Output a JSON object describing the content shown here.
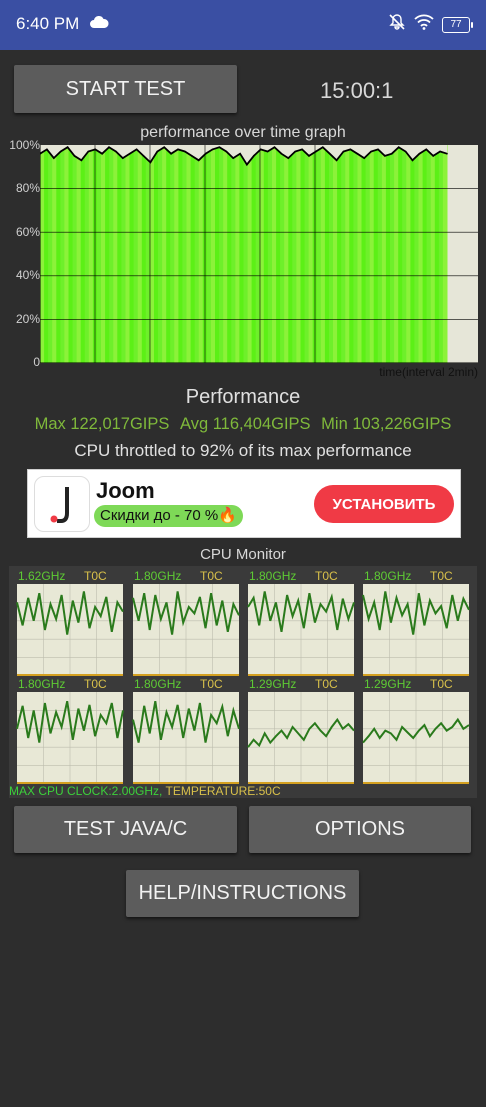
{
  "status_bar": {
    "time": "6:40 PM",
    "battery": "77",
    "icons": [
      "cloud-icon",
      "mute-icon",
      "wifi-icon",
      "battery-icon"
    ]
  },
  "controls": {
    "start_label": "START TEST",
    "timer": "15:00:1"
  },
  "graph": {
    "title": "performance over time graph",
    "y_ticks": [
      "100%",
      "80%",
      "60%",
      "40%",
      "20%",
      "0"
    ],
    "x_label": "time(interval 2min)",
    "colors": {
      "fill": "#5cf016",
      "line": "#000000",
      "background": "#e6e6d8",
      "grid": "#000000"
    }
  },
  "chart_data": {
    "type": "area",
    "title": "performance over time graph",
    "xlabel": "time(interval 2min)",
    "ylabel": "",
    "ylim": [
      0,
      100
    ],
    "y_ticks": [
      "100%",
      "80%",
      "60%",
      "40%",
      "20%",
      "0"
    ],
    "series": [
      {
        "values": [
          96,
          98,
          94,
          97,
          99,
          95,
          93,
          97,
          98,
          96,
          99,
          97,
          94,
          96,
          98,
          95,
          92,
          97,
          99,
          96,
          98,
          97,
          95,
          93,
          96,
          98,
          99,
          97,
          94,
          96,
          91,
          95,
          98,
          97,
          99,
          96,
          94,
          97,
          98,
          95,
          97,
          99,
          96,
          93,
          97,
          98,
          96,
          94,
          97,
          98,
          95,
          96,
          99,
          97,
          93,
          96,
          98,
          95,
          97,
          96
        ]
      }
    ]
  },
  "performance": {
    "title": "Performance",
    "max": "Max 122,017GIPS",
    "avg": "Avg 116,404GIPS",
    "min": "Min 103,226GIPS",
    "throttled": "CPU throttled to 92% of its max performance"
  },
  "ad": {
    "name": "Joom",
    "promo": "Скидки до - 70 %🔥",
    "install": "УСТАНОВИТЬ",
    "icon": "joom-logo-icon"
  },
  "cpu_monitor": {
    "title": "CPU Monitor",
    "cores": [
      {
        "freq": "1.62GHz",
        "temp": "T0C",
        "values": [
          80,
          55,
          85,
          60,
          90,
          50,
          78,
          62,
          88,
          45,
          82,
          58,
          92,
          52,
          75,
          65,
          86,
          48,
          80,
          70
        ]
      },
      {
        "freq": "1.80GHz",
        "temp": "T0C",
        "values": [
          85,
          60,
          90,
          50,
          88,
          62,
          80,
          45,
          92,
          58,
          75,
          68,
          86,
          52,
          90,
          55,
          82,
          48,
          78,
          66
        ]
      },
      {
        "freq": "1.80GHz",
        "temp": "T0C",
        "values": [
          75,
          85,
          55,
          92,
          60,
          80,
          48,
          88,
          65,
          82,
          52,
          90,
          58,
          78,
          70,
          86,
          50,
          84,
          62,
          80
        ]
      },
      {
        "freq": "1.80GHz",
        "temp": "T0C",
        "values": [
          88,
          62,
          80,
          50,
          92,
          58,
          85,
          66,
          78,
          45,
          90,
          55,
          82,
          68,
          76,
          52,
          88,
          60,
          84,
          72
        ]
      },
      {
        "freq": "1.80GHz",
        "temp": "T0C",
        "values": [
          60,
          85,
          50,
          80,
          45,
          88,
          55,
          78,
          62,
          90,
          48,
          82,
          58,
          86,
          52,
          75,
          66,
          88,
          50,
          80
        ]
      },
      {
        "freq": "1.80GHz",
        "temp": "T0C",
        "values": [
          70,
          45,
          85,
          55,
          90,
          48,
          78,
          62,
          86,
          50,
          82,
          58,
          88,
          45,
          75,
          66,
          84,
          52,
          80,
          60
        ]
      },
      {
        "freq": "1.29GHz",
        "temp": "T0C",
        "values": [
          40,
          48,
          42,
          55,
          45,
          52,
          58,
          50,
          62,
          55,
          48,
          60,
          66,
          58,
          52,
          62,
          70,
          60,
          65,
          58
        ]
      },
      {
        "freq": "1.29GHz",
        "temp": "T0C",
        "values": [
          45,
          52,
          60,
          50,
          58,
          55,
          48,
          62,
          56,
          50,
          58,
          64,
          52,
          60,
          66,
          58,
          62,
          70,
          60,
          64
        ]
      }
    ],
    "max_clock": "MAX CPU CLOCK:2.00GHz,",
    "temperature": "TEMPERATURE:50C"
  },
  "buttons": {
    "test_java": "TEST JAVA/C",
    "options": "OPTIONS",
    "help": "HELP/INSTRUCTIONS"
  }
}
